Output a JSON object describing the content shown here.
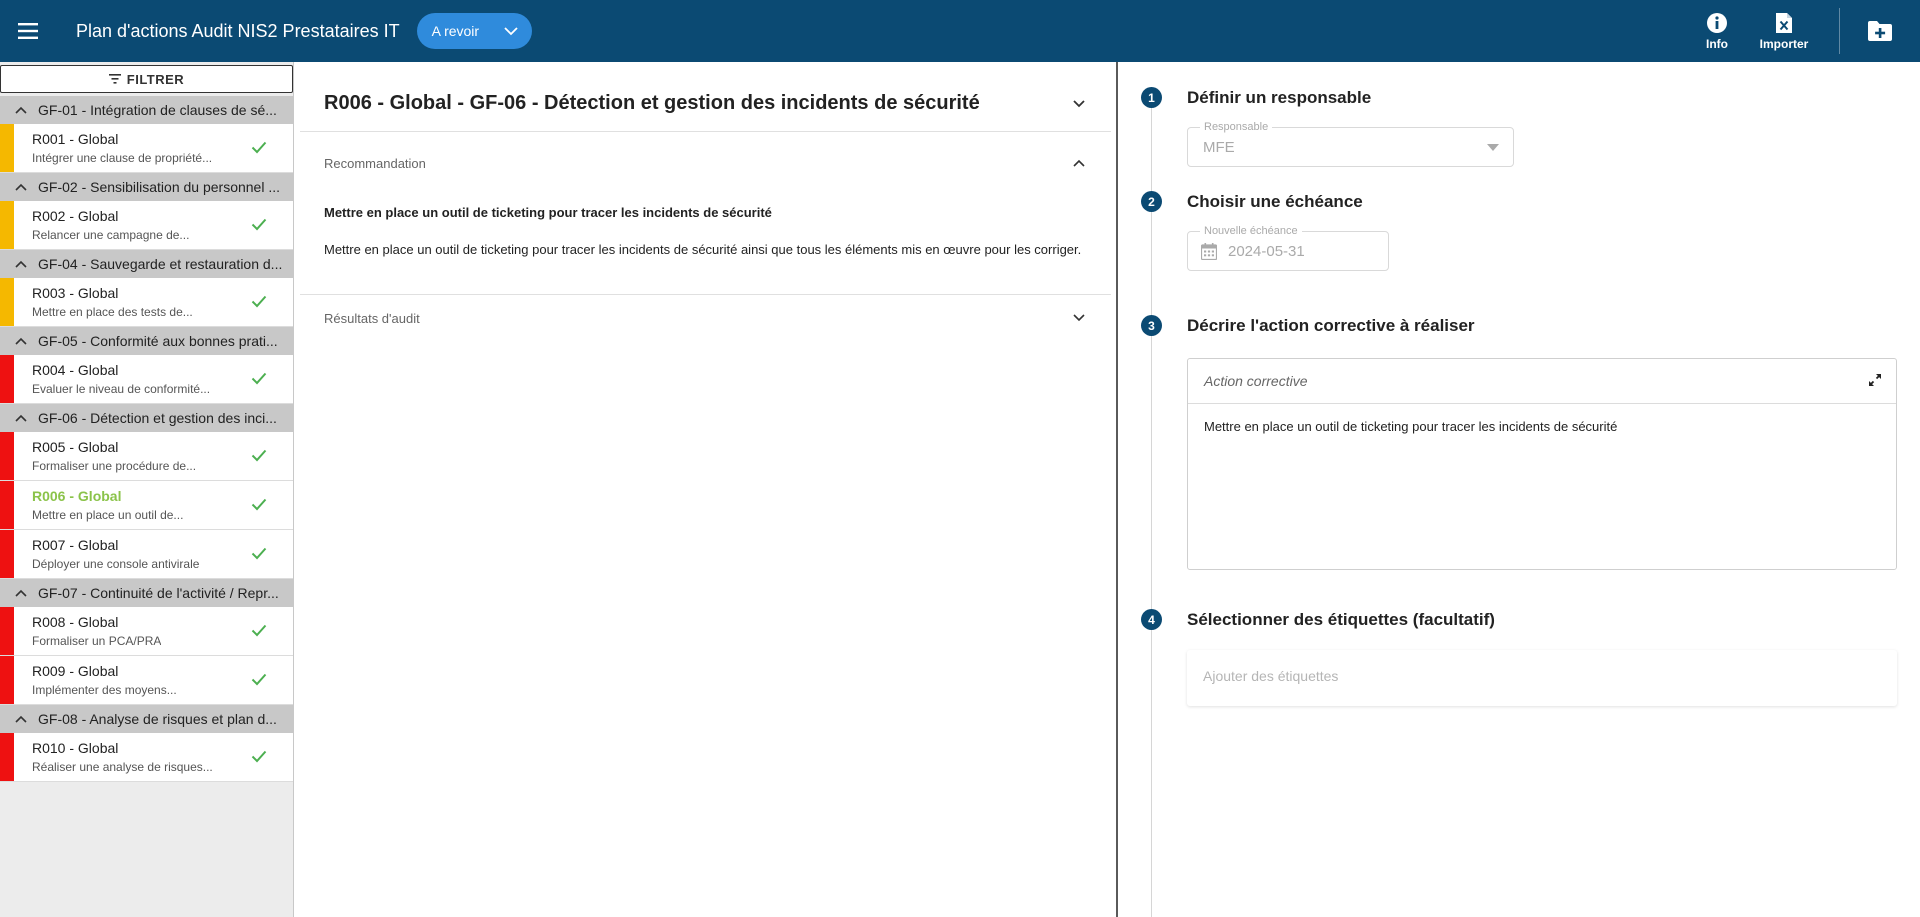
{
  "header": {
    "title": "Plan d'actions Audit NIS2 Prestataires IT",
    "status_label": "A revoir",
    "info_label": "Info",
    "import_label": "Importer",
    "icons": {
      "menu": "hamburger-menu-icon",
      "info": "info-circle-icon",
      "import": "excel-file-icon",
      "new_folder": "folder-plus-icon"
    }
  },
  "sidebar": {
    "filter_label": "FILTRER",
    "groups": [
      {
        "title": "GF-01 - Intégration de clauses de sé...",
        "items": [
          {
            "title": "R001 - Global",
            "subtitle": "Intégrer une clause de propriété...",
            "priority": "#f5b800"
          }
        ]
      },
      {
        "title": "GF-02 - Sensibilisation du personnel ...",
        "items": [
          {
            "title": "R002 - Global",
            "subtitle": "Relancer une campagne de...",
            "priority": "#f5b800"
          }
        ]
      },
      {
        "title": "GF-04 - Sauvegarde et restauration d...",
        "items": [
          {
            "title": "R003 - Global",
            "subtitle": "Mettre en place des tests de...",
            "priority": "#f5b800"
          }
        ]
      },
      {
        "title": "GF-05 - Conformité aux bonnes prati...",
        "items": [
          {
            "title": "R004 - Global",
            "subtitle": "Evaluer le niveau de conformité...",
            "priority": "#ee1111"
          }
        ]
      },
      {
        "title": "GF-06 - Détection et gestion des inci...",
        "items": [
          {
            "title": "R005 - Global",
            "subtitle": "Formaliser une procédure de...",
            "priority": "#ee1111"
          },
          {
            "title": "R006 - Global",
            "subtitle": "Mettre en place un outil de...",
            "priority": "#ee1111",
            "active": true
          },
          {
            "title": "R007 - Global",
            "subtitle": "Déployer une console antivirale",
            "priority": "#ee1111"
          }
        ]
      },
      {
        "title": "GF-07 - Continuité de l'activité / Repr...",
        "items": [
          {
            "title": "R008 - Global",
            "subtitle": "Formaliser un PCA/PRA",
            "priority": "#ee1111"
          },
          {
            "title": "R009 - Global",
            "subtitle": "Implémenter des moyens...",
            "priority": "#ee1111"
          }
        ]
      },
      {
        "title": "GF-08 - Analyse de risques et plan d...",
        "items": [
          {
            "title": "R010 - Global",
            "subtitle": "Réaliser une analyse de risques...",
            "priority": "#ee1111"
          }
        ]
      }
    ]
  },
  "detail": {
    "title": "R006 - Global - GF-06 - Détection et gestion des incidents de sécurité",
    "recommendation_label": "Recommandation",
    "recommendation_title": "Mettre en place un outil de ticketing pour tracer les incidents de sécurité",
    "recommendation_text": "Mettre en place un outil de ticketing pour tracer les incidents de sécurité ainsi que tous les éléments mis en œuvre pour les corriger.",
    "audit_results_label": "Résultats d'audit"
  },
  "form": {
    "steps": [
      {
        "number": "1",
        "title": "Définir un responsable"
      },
      {
        "number": "2",
        "title": "Choisir une échéance"
      },
      {
        "number": "3",
        "title": "Décrire l'action corrective à réaliser"
      },
      {
        "number": "4",
        "title": "Sélectionner des étiquettes (facultatif)"
      }
    ],
    "responsible_label": "Responsable",
    "responsible_value": "MFE",
    "deadline_label": "Nouvelle échéance",
    "deadline_value": "2024-05-31",
    "action_placeholder": "Action corrective",
    "action_value": "Mettre en place un outil de ticketing pour tracer les incidents de sécurité",
    "tags_placeholder": "Ajouter des étiquettes"
  },
  "colors": {
    "primary": "#0b4a73",
    "chip": "#2f8bdc",
    "check": "#4caf50",
    "active_item": "#8bc34a"
  }
}
